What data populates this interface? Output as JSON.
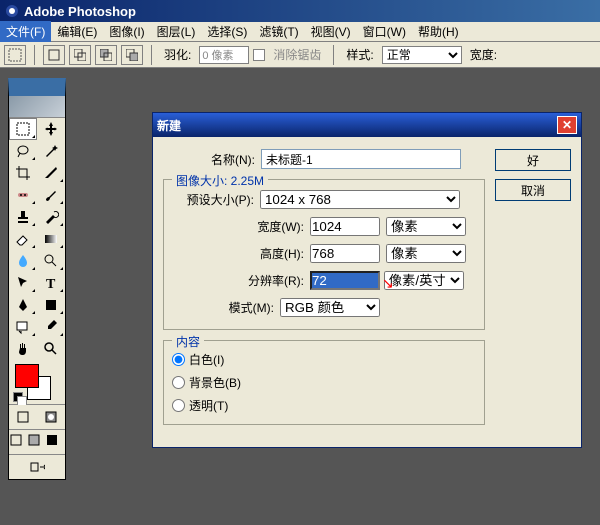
{
  "app": {
    "title": "Adobe Photoshop"
  },
  "menu": {
    "file": "文件(F)",
    "edit": "编辑(E)",
    "image": "图像(I)",
    "layer": "图层(L)",
    "select": "选择(S)",
    "filter": "滤镜(T)",
    "view": "视图(V)",
    "window": "窗口(W)",
    "help": "帮助(H)"
  },
  "options": {
    "feather_label": "羽化:",
    "feather_value": "0 像素",
    "antialias": "消除锯齿",
    "style_label": "样式:",
    "style_value": "正常",
    "width_label": "宽度:"
  },
  "dialog": {
    "title": "新建",
    "ok": "好",
    "cancel": "取消",
    "name_label": "名称(N):",
    "name_value": "未标题-1",
    "size_group": "图像大小: 2.25M",
    "preset_label": "预设大小(P):",
    "preset_value": "1024 x 768",
    "width_label": "宽度(W):",
    "width_value": "1024",
    "width_unit": "像素",
    "height_label": "高度(H):",
    "height_value": "768",
    "height_unit": "像素",
    "res_label": "分辨率(R):",
    "res_value": "72",
    "res_unit": "像素/英寸",
    "mode_label": "模式(M):",
    "mode_value": "RGB 颜色",
    "content_group": "内容",
    "white": "白色(I)",
    "bgcolor": "背景色(B)",
    "transparent": "透明(T)"
  },
  "colors": {
    "fg": "#ff0000",
    "bg": "#ffffff"
  }
}
